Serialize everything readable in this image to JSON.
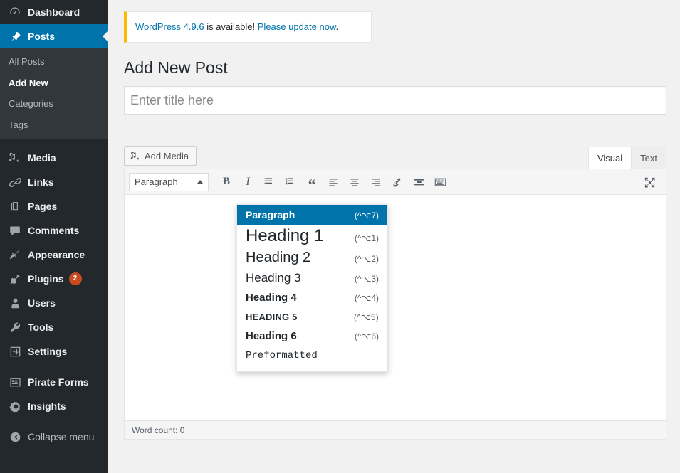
{
  "sidebar": {
    "items": [
      {
        "label": "Dashboard",
        "icon": "dashboard-icon",
        "name": "dashboard",
        "current": false
      },
      {
        "label": "Posts",
        "icon": "pin-icon",
        "name": "posts",
        "current": true
      },
      {
        "label": "Media",
        "icon": "media-icon",
        "name": "media",
        "current": false
      },
      {
        "label": "Links",
        "icon": "link-icon",
        "name": "links",
        "current": false
      },
      {
        "label": "Pages",
        "icon": "pages-icon",
        "name": "pages",
        "current": false
      },
      {
        "label": "Comments",
        "icon": "comments-icon",
        "name": "comments",
        "current": false
      },
      {
        "label": "Appearance",
        "icon": "paintbrush-icon",
        "name": "appearance",
        "current": false
      },
      {
        "label": "Plugins",
        "icon": "plugins-icon",
        "name": "plugins",
        "current": false,
        "badge": "2"
      },
      {
        "label": "Users",
        "icon": "users-icon",
        "name": "users",
        "current": false
      },
      {
        "label": "Tools",
        "icon": "wrench-icon",
        "name": "tools",
        "current": false
      },
      {
        "label": "Settings",
        "icon": "settings-icon",
        "name": "settings",
        "current": false
      },
      {
        "label": "Pirate Forms",
        "icon": "form-icon",
        "name": "pirate-forms",
        "current": false
      },
      {
        "label": "Insights",
        "icon": "insights-icon",
        "name": "insights",
        "current": false
      }
    ],
    "submenu": [
      {
        "label": "All Posts",
        "current": false
      },
      {
        "label": "Add New",
        "current": true
      },
      {
        "label": "Categories",
        "current": false
      },
      {
        "label": "Tags",
        "current": false
      }
    ],
    "collapse_label": "Collapse menu",
    "badge_color": "#ca4a1f",
    "current_color": "#0073aa"
  },
  "notice": {
    "link_version": "WordPress 4.9.6",
    "mid_text": " is available! ",
    "link_update": "Please update now",
    "end_text": ".",
    "accent_color": "#ffb900"
  },
  "page": {
    "title": "Add New Post"
  },
  "title_field": {
    "placeholder": "Enter title here",
    "value": ""
  },
  "toolbar": {
    "add_media_label": "Add Media",
    "format_selected": "Paragraph",
    "buttons": [
      {
        "name": "bold-button",
        "label": "B"
      },
      {
        "name": "italic-button",
        "label": "I"
      },
      {
        "name": "bulleted-list-button",
        "label": ""
      },
      {
        "name": "numbered-list-button",
        "label": ""
      },
      {
        "name": "blockquote-button",
        "label": "“"
      },
      {
        "name": "align-left-button",
        "label": ""
      },
      {
        "name": "align-center-button",
        "label": ""
      },
      {
        "name": "align-right-button",
        "label": ""
      },
      {
        "name": "insert-link-button",
        "label": ""
      },
      {
        "name": "read-more-button",
        "label": ""
      },
      {
        "name": "toolbar-toggle-button",
        "label": ""
      }
    ],
    "fullscreen_name": "fullscreen-button"
  },
  "editor_tabs": [
    {
      "label": "Visual",
      "active": true
    },
    {
      "label": "Text",
      "active": false
    }
  ],
  "statusbar": {
    "word_count": "Word count: 0"
  },
  "format_menu": {
    "items": [
      {
        "label": "Paragraph",
        "shortcut": "(^⌥7)",
        "style": "fm-p",
        "selected": true
      },
      {
        "label": "Heading 1",
        "shortcut": "(^⌥1)",
        "style": "fm-h1",
        "selected": false
      },
      {
        "label": "Heading 2",
        "shortcut": "(^⌥2)",
        "style": "fm-h2",
        "selected": false
      },
      {
        "label": "Heading 3",
        "shortcut": "(^⌥3)",
        "style": "fm-h3",
        "selected": false
      },
      {
        "label": "Heading 4",
        "shortcut": "(^⌥4)",
        "style": "fm-h4",
        "selected": false
      },
      {
        "label": "HEADING 5",
        "shortcut": "(^⌥5)",
        "style": "fm-h5",
        "selected": false
      },
      {
        "label": "Heading 6",
        "shortcut": "(^⌥6)",
        "style": "fm-h6",
        "selected": false
      },
      {
        "label": "Preformatted",
        "shortcut": "",
        "style": "fm-pre",
        "selected": false
      }
    ]
  }
}
